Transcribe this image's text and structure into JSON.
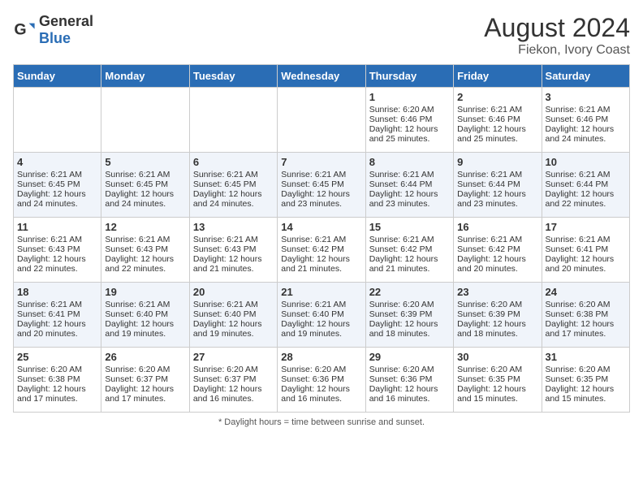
{
  "header": {
    "logo_general": "General",
    "logo_blue": "Blue",
    "month_year": "August 2024",
    "location": "Fiekon, Ivory Coast"
  },
  "days_of_week": [
    "Sunday",
    "Monday",
    "Tuesday",
    "Wednesday",
    "Thursday",
    "Friday",
    "Saturday"
  ],
  "footer": {
    "note": "Daylight hours"
  },
  "weeks": [
    [
      {
        "day": "",
        "info": ""
      },
      {
        "day": "",
        "info": ""
      },
      {
        "day": "",
        "info": ""
      },
      {
        "day": "",
        "info": ""
      },
      {
        "day": "1",
        "info": "Sunrise: 6:20 AM\nSunset: 6:46 PM\nDaylight: 12 hours\nand 25 minutes."
      },
      {
        "day": "2",
        "info": "Sunrise: 6:21 AM\nSunset: 6:46 PM\nDaylight: 12 hours\nand 25 minutes."
      },
      {
        "day": "3",
        "info": "Sunrise: 6:21 AM\nSunset: 6:46 PM\nDaylight: 12 hours\nand 24 minutes."
      }
    ],
    [
      {
        "day": "4",
        "info": "Sunrise: 6:21 AM\nSunset: 6:45 PM\nDaylight: 12 hours\nand 24 minutes."
      },
      {
        "day": "5",
        "info": "Sunrise: 6:21 AM\nSunset: 6:45 PM\nDaylight: 12 hours\nand 24 minutes."
      },
      {
        "day": "6",
        "info": "Sunrise: 6:21 AM\nSunset: 6:45 PM\nDaylight: 12 hours\nand 24 minutes."
      },
      {
        "day": "7",
        "info": "Sunrise: 6:21 AM\nSunset: 6:45 PM\nDaylight: 12 hours\nand 23 minutes."
      },
      {
        "day": "8",
        "info": "Sunrise: 6:21 AM\nSunset: 6:44 PM\nDaylight: 12 hours\nand 23 minutes."
      },
      {
        "day": "9",
        "info": "Sunrise: 6:21 AM\nSunset: 6:44 PM\nDaylight: 12 hours\nand 23 minutes."
      },
      {
        "day": "10",
        "info": "Sunrise: 6:21 AM\nSunset: 6:44 PM\nDaylight: 12 hours\nand 22 minutes."
      }
    ],
    [
      {
        "day": "11",
        "info": "Sunrise: 6:21 AM\nSunset: 6:43 PM\nDaylight: 12 hours\nand 22 minutes."
      },
      {
        "day": "12",
        "info": "Sunrise: 6:21 AM\nSunset: 6:43 PM\nDaylight: 12 hours\nand 22 minutes."
      },
      {
        "day": "13",
        "info": "Sunrise: 6:21 AM\nSunset: 6:43 PM\nDaylight: 12 hours\nand 21 minutes."
      },
      {
        "day": "14",
        "info": "Sunrise: 6:21 AM\nSunset: 6:42 PM\nDaylight: 12 hours\nand 21 minutes."
      },
      {
        "day": "15",
        "info": "Sunrise: 6:21 AM\nSunset: 6:42 PM\nDaylight: 12 hours\nand 21 minutes."
      },
      {
        "day": "16",
        "info": "Sunrise: 6:21 AM\nSunset: 6:42 PM\nDaylight: 12 hours\nand 20 minutes."
      },
      {
        "day": "17",
        "info": "Sunrise: 6:21 AM\nSunset: 6:41 PM\nDaylight: 12 hours\nand 20 minutes."
      }
    ],
    [
      {
        "day": "18",
        "info": "Sunrise: 6:21 AM\nSunset: 6:41 PM\nDaylight: 12 hours\nand 20 minutes."
      },
      {
        "day": "19",
        "info": "Sunrise: 6:21 AM\nSunset: 6:40 PM\nDaylight: 12 hours\nand 19 minutes."
      },
      {
        "day": "20",
        "info": "Sunrise: 6:21 AM\nSunset: 6:40 PM\nDaylight: 12 hours\nand 19 minutes."
      },
      {
        "day": "21",
        "info": "Sunrise: 6:21 AM\nSunset: 6:40 PM\nDaylight: 12 hours\nand 19 minutes."
      },
      {
        "day": "22",
        "info": "Sunrise: 6:20 AM\nSunset: 6:39 PM\nDaylight: 12 hours\nand 18 minutes."
      },
      {
        "day": "23",
        "info": "Sunrise: 6:20 AM\nSunset: 6:39 PM\nDaylight: 12 hours\nand 18 minutes."
      },
      {
        "day": "24",
        "info": "Sunrise: 6:20 AM\nSunset: 6:38 PM\nDaylight: 12 hours\nand 17 minutes."
      }
    ],
    [
      {
        "day": "25",
        "info": "Sunrise: 6:20 AM\nSunset: 6:38 PM\nDaylight: 12 hours\nand 17 minutes."
      },
      {
        "day": "26",
        "info": "Sunrise: 6:20 AM\nSunset: 6:37 PM\nDaylight: 12 hours\nand 17 minutes."
      },
      {
        "day": "27",
        "info": "Sunrise: 6:20 AM\nSunset: 6:37 PM\nDaylight: 12 hours\nand 16 minutes."
      },
      {
        "day": "28",
        "info": "Sunrise: 6:20 AM\nSunset: 6:36 PM\nDaylight: 12 hours\nand 16 minutes."
      },
      {
        "day": "29",
        "info": "Sunrise: 6:20 AM\nSunset: 6:36 PM\nDaylight: 12 hours\nand 16 minutes."
      },
      {
        "day": "30",
        "info": "Sunrise: 6:20 AM\nSunset: 6:35 PM\nDaylight: 12 hours\nand 15 minutes."
      },
      {
        "day": "31",
        "info": "Sunrise: 6:20 AM\nSunset: 6:35 PM\nDaylight: 12 hours\nand 15 minutes."
      }
    ]
  ]
}
